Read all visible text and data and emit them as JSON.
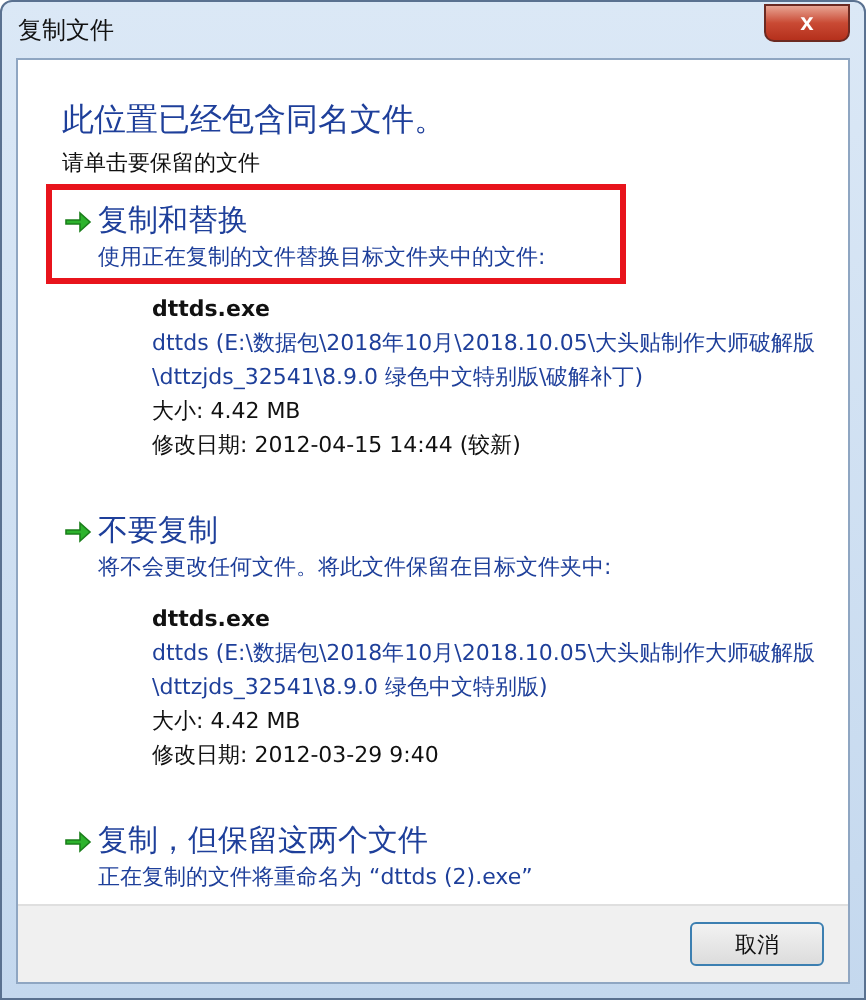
{
  "window": {
    "title": "复制文件",
    "close": "x"
  },
  "heading": "此位置已经包含同名文件。",
  "instruction": "请单击要保留的文件",
  "options": [
    {
      "title": "复制和替换",
      "description": "使用正在复制的文件替换目标文件夹中的文件:",
      "highlighted": true,
      "file": {
        "name": "dttds.exe",
        "path": [
          "dttds (E:\\数据包\\2018年10月\\2018.10.05\\大头贴制作大师破解版",
          "\\dttzjds_32541\\8.9.0 绿色中文特别版\\破解补丁)"
        ],
        "size": "大小: 4.42 MB",
        "modified": "修改日期: 2012-04-15 14:44 (较新)"
      }
    },
    {
      "title": "不要复制",
      "description": "将不会更改任何文件。将此文件保留在目标文件夹中:",
      "highlighted": false,
      "file": {
        "name": "dttds.exe",
        "path": [
          "dttds (E:\\数据包\\2018年10月\\2018.10.05\\大头贴制作大师破解版",
          "\\dttzjds_32541\\8.9.0 绿色中文特别版)"
        ],
        "size": "大小: 4.42 MB",
        "modified": "修改日期: 2012-03-29 9:40"
      }
    },
    {
      "title": "复制，但保留这两个文件",
      "description": "正在复制的文件将重命名为 “dttds (2).exe”",
      "highlighted": false
    }
  ],
  "buttons": [
    "取消"
  ]
}
